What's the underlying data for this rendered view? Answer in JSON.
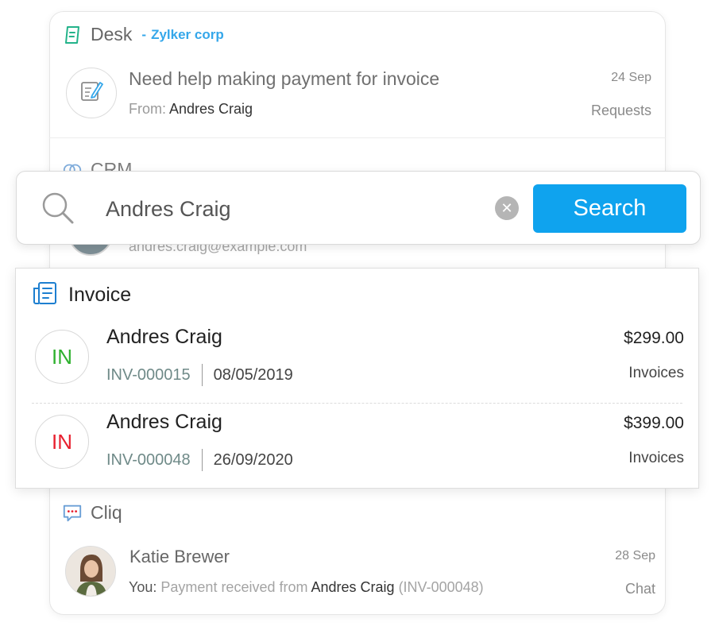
{
  "desk": {
    "app_name": "Desk",
    "separator": "-",
    "org_name": "Zylker corp",
    "ticket": {
      "subject": "Need help making payment for invoice",
      "from_label": "From:",
      "from_name": "Andres Craig",
      "date": "24 Sep",
      "department": "Requests"
    }
  },
  "crm": {
    "app_name": "CRM",
    "email": "andres.craig@example.com"
  },
  "search": {
    "query": "Andres Craig",
    "button_label": "Search",
    "clear_symbol": "✕"
  },
  "invoice": {
    "title": "Invoice",
    "rows": [
      {
        "badge": "IN",
        "badge_color": "#2fb12f",
        "name": "Andres Craig",
        "number": "INV-000015",
        "date": "08/05/2019",
        "amount": "$299.00",
        "module": "Invoices"
      },
      {
        "badge": "IN",
        "badge_color": "#e8202f",
        "name": "Andres Craig",
        "number": "INV-000048",
        "date": "26/09/2020",
        "amount": "$399.00",
        "module": "Invoices"
      }
    ]
  },
  "cliq": {
    "app_name": "Cliq",
    "chat": {
      "name": "Katie Brewer",
      "prefix": "You:",
      "message": "Payment received from",
      "mention": "Andres Craig",
      "ref": "(INV-000048)",
      "date": "28 Sep",
      "channel": "Chat"
    }
  },
  "colors": {
    "accent": "#0fa3ee",
    "org_link": "#35a7ea",
    "desk_icon": "#23b38a",
    "invoice_icon": "#1d7fd0"
  },
  "icons": {
    "desk": "desk-icon",
    "crm": "crm-icon",
    "search": "search-icon",
    "clear": "clear-icon",
    "invoice": "invoice-icon",
    "cliq": "cliq-icon",
    "ticket": "edit-document-icon"
  }
}
